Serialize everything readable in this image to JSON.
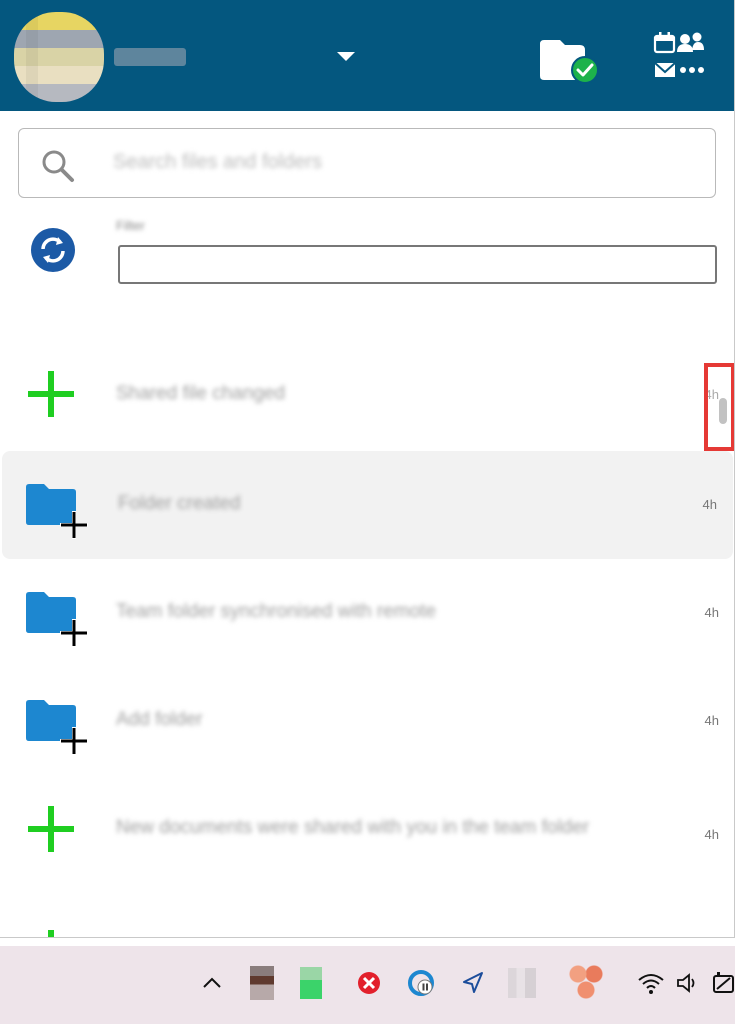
{
  "header": {
    "username": "user"
  },
  "search": {
    "query": "Search files and folders"
  },
  "filter": {
    "label": "Filter",
    "value": ""
  },
  "activity": [
    {
      "title": "Shared file changed",
      "time": "4h"
    },
    {
      "title": "Folder created",
      "time": "4h"
    },
    {
      "title": "Team folder synchronised with remote",
      "time": "4h"
    },
    {
      "title": "Add folder",
      "time": "4h"
    },
    {
      "title": "New documents were shared with you in the team folder",
      "time": "4h"
    }
  ],
  "colors": {
    "header": "#04577f",
    "folder": "#1d87d0",
    "plus_green": "#1fce21",
    "highlight": "#e53935",
    "taskbar": "#eee4ea"
  }
}
